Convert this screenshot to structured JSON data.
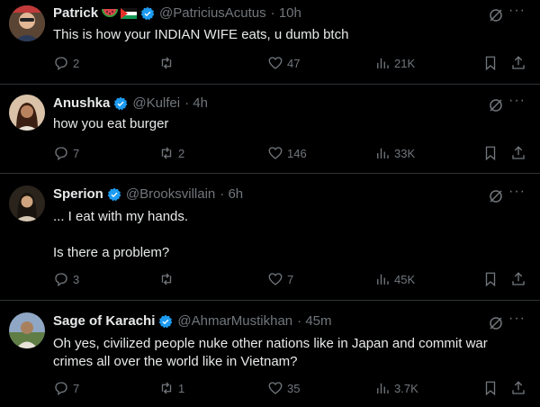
{
  "tweets": [
    {
      "name": "Patrick",
      "handle": "@PatriciusAcutus",
      "time": "· 10h",
      "text": "This is how your INDIAN WIFE eats, u dumb btch",
      "replies": "2",
      "reposts": "",
      "likes": "47",
      "views": "21K",
      "avatar_color": "#c9a27a"
    },
    {
      "name": "Anushka",
      "handle": "@Kulfei",
      "time": "· 4h",
      "text": "how you eat burger",
      "replies": "7",
      "reposts": "2",
      "likes": "146",
      "views": "33K",
      "avatar_color": "#b46a3e"
    },
    {
      "name": "Sperion",
      "handle": "@Brooksvillain",
      "time": "· 6h",
      "text": "... I eat with my hands.\n\nIs there a problem?",
      "replies": "3",
      "reposts": "",
      "likes": "7",
      "views": "45K",
      "avatar_color": "#3a2f22"
    },
    {
      "name": "Sage of Karachi",
      "handle": "@AhmarMustikhan",
      "time": "· 45m",
      "text": "Oh yes, civilized people nuke other nations like in Japan and commit war crimes all over the world like in Vietnam?",
      "replies": "7",
      "reposts": "1",
      "likes": "35",
      "views": "3.7K",
      "avatar_color": "#6b8f5a"
    }
  ],
  "colors": {
    "verified": "#1d9bf0",
    "muted": "#71767b",
    "text": "#e7e9ea",
    "divider": "#2f3336"
  },
  "icons": [
    "grok-icon",
    "more-icon",
    "reply-icon",
    "repost-icon",
    "like-icon",
    "views-icon",
    "bookmark-icon",
    "share-icon",
    "verified-badge-icon",
    "watermelon-icon",
    "palestine-flag-icon"
  ]
}
